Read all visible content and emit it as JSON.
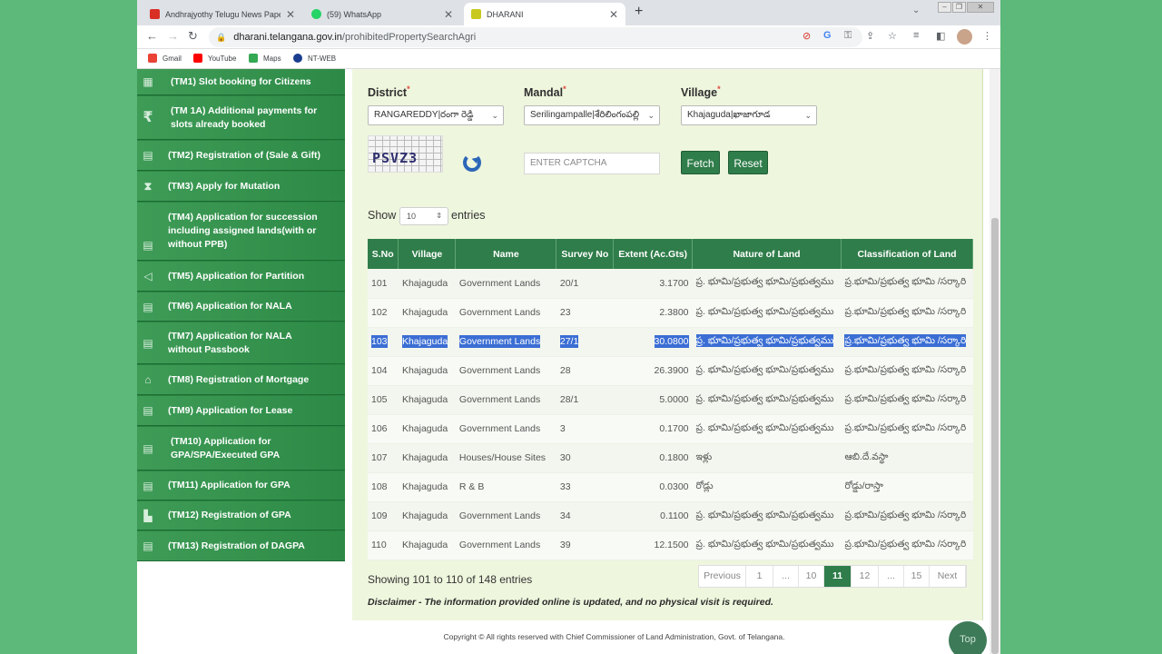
{
  "browser": {
    "tabs": [
      {
        "title": "Andhrajyothy Telugu News Paper, ..."
      },
      {
        "title": "(59) WhatsApp"
      },
      {
        "title": "DHARANI"
      }
    ],
    "url_host": "dharani.telangana.gov.in",
    "url_path": "/prohibitedPropertySearchAgri",
    "bookmarks": [
      "Gmail",
      "YouTube",
      "Maps",
      "NT-WEB"
    ]
  },
  "sidebar": {
    "items": [
      {
        "label": "(TM1) Slot booking for Citizens"
      },
      {
        "label": "(TM 1A) Additional payments for slots already booked"
      },
      {
        "label": "(TM2) Registration of (Sale & Gift)"
      },
      {
        "label": "(TM3) Apply for Mutation"
      },
      {
        "label": "(TM4) Application for succession including assigned lands(with or without PPB)"
      },
      {
        "label": "(TM5) Application for Partition"
      },
      {
        "label": "(TM6) Application for NALA"
      },
      {
        "label": "(TM7) Application for NALA without Passbook"
      },
      {
        "label": "(TM8) Registration of Mortgage"
      },
      {
        "label": "(TM9) Application for Lease"
      },
      {
        "label": "(TM10) Application for GPA/SPA/Executed GPA"
      },
      {
        "label": "(TM11) Application for GPA"
      },
      {
        "label": "(TM12) Registration of GPA"
      },
      {
        "label": "(TM13) Registration of DAGPA"
      }
    ]
  },
  "form": {
    "district_label": "District",
    "district_value": "RANGAREDDY|రంగా రెడ్డి",
    "mandal_label": "Mandal",
    "mandal_value": "Serilingampalle|శేరిలింగంపల్లి",
    "village_label": "Village",
    "village_value": "Khajaguda|ఖాజాగూడ",
    "captcha_text": "PSVZ3",
    "captcha_placeholder": "ENTER CAPTCHA",
    "fetch_label": "Fetch",
    "reset_label": "Reset"
  },
  "table": {
    "show_label": "Show",
    "page_size": "10",
    "entries_label": "entries",
    "columns": [
      "S.No",
      "Village",
      "Name",
      "Survey No",
      "Extent (Ac.Gts)",
      "Nature of Land",
      "Classification of Land"
    ],
    "rows": [
      [
        "101",
        "Khajaguda",
        "Government Lands",
        "20/1",
        "3.1700",
        "ప్ర. భూమి/ప్రభుత్వ భూమి/ప్రభుత్వము",
        "ప్ర.భూమి/ప్రభుత్వ భూమి /సర్కారి"
      ],
      [
        "102",
        "Khajaguda",
        "Government Lands",
        "23",
        "2.3800",
        "ప్ర. భూమి/ప్రభుత్వ భూమి/ప్రభుత్వము",
        "ప్ర.భూమి/ప్రభుత్వ భూమి /సర్కారి"
      ],
      [
        "103",
        "Khajaguda",
        "Government Lands",
        "27/1",
        "30.0800",
        "ప్ర. భూమి/ప్రభుత్వ భూమి/ప్రభుత్వము",
        "ప్ర.భూమి/ప్రభుత్వ భూమి /సర్కారి"
      ],
      [
        "104",
        "Khajaguda",
        "Government Lands",
        "28",
        "26.3900",
        "ప్ర. భూమి/ప్రభుత్వ భూమి/ప్రభుత్వము",
        "ప్ర.భూమి/ప్రభుత్వ భూమి /సర్కారి"
      ],
      [
        "105",
        "Khajaguda",
        "Government Lands",
        "28/1",
        "5.0000",
        "ప్ర. భూమి/ప్రభుత్వ భూమి/ప్రభుత్వము",
        "ప్ర.భూమి/ప్రభుత్వ భూమి /సర్కారి"
      ],
      [
        "106",
        "Khajaguda",
        "Government Lands",
        "3",
        "0.1700",
        "ప్ర. భూమి/ప్రభుత్వ భూమి/ప్రభుత్వము",
        "ప్ర.భూమి/ప్రభుత్వ భూమి /సర్కారి"
      ],
      [
        "107",
        "Khajaguda",
        "Houses/House Sites",
        "30",
        "0.1800",
        "ఇళ్లు",
        "ఆబి.దే.వస్థా"
      ],
      [
        "108",
        "Khajaguda",
        "R & B",
        "33",
        "0.0300",
        "రోడ్లు",
        "రోడ్డు/రాస్తా"
      ],
      [
        "109",
        "Khajaguda",
        "Government Lands",
        "34",
        "0.1100",
        "ప్ర. భూమి/ప్రభుత్వ భూమి/ప్రభుత్వము",
        "ప్ర.భూమి/ప్రభుత్వ భూమి /సర్కారి"
      ],
      [
        "110",
        "Khajaguda",
        "Government Lands",
        "39",
        "12.1500",
        "ప్ర. భూమి/ప్రభుత్వ భూమి/ప్రభుత్వము",
        "ప్ర.భూమి/ప్రభుత్వ భూమి /సర్కారి"
      ]
    ],
    "selected_row": "103",
    "info": "Showing 101 to 110 of 148 entries",
    "pagination": [
      "Previous",
      "1",
      "...",
      "10",
      "11",
      "12",
      "...",
      "15",
      "Next"
    ],
    "current_page": "11"
  },
  "disclaimer": "Disclaimer - The information provided online is updated, and no physical visit is required.",
  "footer": "Copyright © All rights reserved with Chief Commissioner of Land Administration, Govt. of Telangana.",
  "top_label": "Top",
  "colors": {
    "brand_green": "#2f7d4a",
    "selection_blue": "#3b6ed4",
    "background_green": "#5cb97a"
  }
}
